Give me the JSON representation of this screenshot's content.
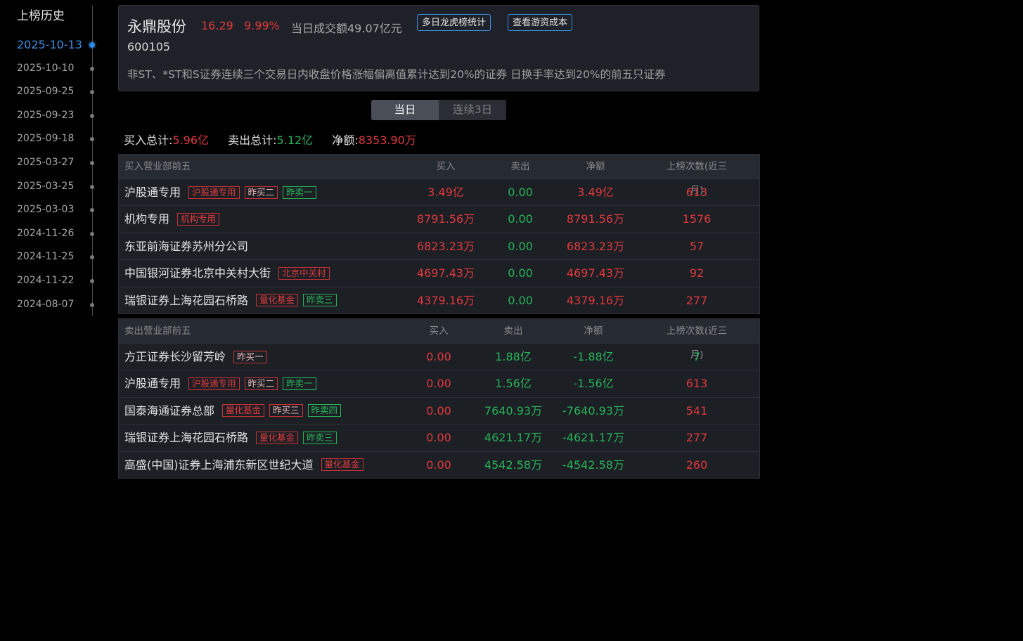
{
  "sidebar": {
    "title": "上榜历史",
    "dates": [
      {
        "date": "2025-10-13",
        "active": true
      },
      {
        "date": "2025-10-10",
        "active": false
      },
      {
        "date": "2025-09-25",
        "active": false
      },
      {
        "date": "2025-09-23",
        "active": false
      },
      {
        "date": "2025-09-18",
        "active": false
      },
      {
        "date": "2025-03-27",
        "active": false
      },
      {
        "date": "2025-03-25",
        "active": false
      },
      {
        "date": "2025-03-03",
        "active": false
      },
      {
        "date": "2024-11-26",
        "active": false
      },
      {
        "date": "2024-11-25",
        "active": false
      },
      {
        "date": "2024-11-22",
        "active": false
      },
      {
        "date": "2024-08-07",
        "active": false
      }
    ]
  },
  "header": {
    "name": "永鼎股份",
    "price": "16.29",
    "change_pct": "9.99%",
    "turnover": "当日成交额49.07亿元",
    "btn_stats": "多日龙虎榜统计",
    "btn_cost": "查看游资成本",
    "code": "600105",
    "reason": "非ST、*ST和S证券连续三个交易日内收盘价格涨幅偏离值累计达到20%的证券 日换手率达到20%的前五只证券"
  },
  "tabs": [
    {
      "label": "当日",
      "active": true
    },
    {
      "label": "连续3日",
      "active": false
    }
  ],
  "summary": {
    "buy_label": "买入总计:",
    "buy_value": "5.96亿",
    "sell_label": "卖出总计:",
    "sell_value": "5.12亿",
    "net_label": "净额:",
    "net_value": "8353.90万"
  },
  "buy_table": {
    "headers": [
      "买入营业部前五",
      "买入",
      "卖出",
      "净额",
      "上榜次数(近三月)"
    ],
    "rows": [
      {
        "name": "沪股通专用",
        "tags": [
          {
            "text": "沪股通专用",
            "style": "red"
          },
          {
            "text": "昨买二",
            "style": "pink"
          },
          {
            "text": "昨卖一",
            "style": "green"
          }
        ],
        "buy": "3.49亿",
        "sell": "0.00",
        "net": "3.49亿",
        "count": "613"
      },
      {
        "name": "机构专用",
        "tags": [
          {
            "text": "机构专用",
            "style": "red"
          }
        ],
        "buy": "8791.56万",
        "sell": "0.00",
        "net": "8791.56万",
        "count": "1576"
      },
      {
        "name": "东亚前海证券苏州分公司",
        "tags": [],
        "buy": "6823.23万",
        "sell": "0.00",
        "net": "6823.23万",
        "count": "57"
      },
      {
        "name": "中国银河证券北京中关村大街",
        "tags": [
          {
            "text": "北京中关村",
            "style": "red"
          }
        ],
        "buy": "4697.43万",
        "sell": "0.00",
        "net": "4697.43万",
        "count": "92"
      },
      {
        "name": "瑞银证券上海花园石桥路",
        "tags": [
          {
            "text": "量化基金",
            "style": "red"
          },
          {
            "text": "昨卖三",
            "style": "green"
          }
        ],
        "buy": "4379.16万",
        "sell": "0.00",
        "net": "4379.16万",
        "count": "277"
      }
    ]
  },
  "sell_table": {
    "headers": [
      "卖出营业部前五",
      "买入",
      "卖出",
      "净额",
      "上榜次数(近三月)"
    ],
    "rows": [
      {
        "name": "方正证券长沙留芳岭",
        "tags": [
          {
            "text": "昨买一",
            "style": "pink"
          }
        ],
        "buy": "0.00",
        "sell": "1.88亿",
        "net": "-1.88亿",
        "count": "7"
      },
      {
        "name": "沪股通专用",
        "tags": [
          {
            "text": "沪股通专用",
            "style": "red"
          },
          {
            "text": "昨买二",
            "style": "pink"
          },
          {
            "text": "昨卖一",
            "style": "green"
          }
        ],
        "buy": "0.00",
        "sell": "1.56亿",
        "net": "-1.56亿",
        "count": "613"
      },
      {
        "name": "国泰海通证券总部",
        "tags": [
          {
            "text": "量化基金",
            "style": "red"
          },
          {
            "text": "昨买三",
            "style": "pink"
          },
          {
            "text": "昨卖四",
            "style": "green"
          }
        ],
        "buy": "0.00",
        "sell": "7640.93万",
        "net": "-7640.93万",
        "count": "541"
      },
      {
        "name": "瑞银证券上海花园石桥路",
        "tags": [
          {
            "text": "量化基金",
            "style": "red"
          },
          {
            "text": "昨卖三",
            "style": "green"
          }
        ],
        "buy": "0.00",
        "sell": "4621.17万",
        "net": "-4621.17万",
        "count": "277"
      },
      {
        "name": "高盛(中国)证券上海浦东新区世纪大道",
        "tags": [
          {
            "text": "量化基金",
            "style": "red"
          }
        ],
        "buy": "0.00",
        "sell": "4542.58万",
        "net": "-4542.58万",
        "count": "260"
      }
    ]
  },
  "colors": {
    "up": "#e0393e",
    "down": "#27b35a",
    "accent": "#3b8fe0"
  }
}
